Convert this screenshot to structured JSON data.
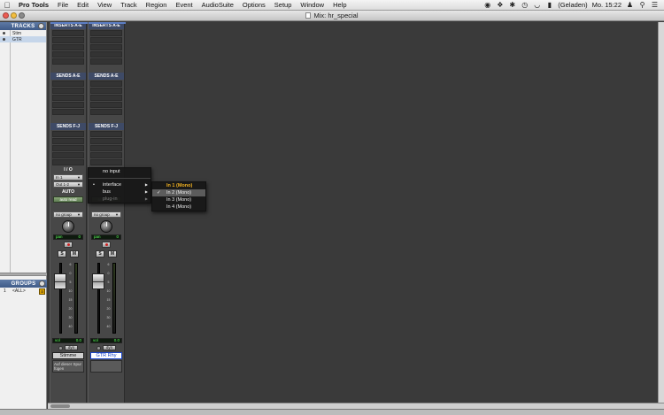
{
  "menubar": {
    "items": [
      "Pro Tools",
      "File",
      "Edit",
      "View",
      "Track",
      "Region",
      "Event",
      "AudioSuite",
      "Options",
      "Setup",
      "Window",
      "Help"
    ],
    "battery": "(Geladen)",
    "clock": "Mo. 15:22"
  },
  "window": {
    "title": "Mix: hr_special"
  },
  "tracks_panel": {
    "title": "TRACKS",
    "rows": [
      "Stim",
      "GTR"
    ]
  },
  "groups_panel": {
    "title": "GROUPS",
    "row": {
      "id": "1",
      "name": "<ALL>"
    }
  },
  "strips": [
    {
      "inserts_ae": "INSERTS A-E",
      "sends_ae": "SENDS A-E",
      "sends_fj": "SENDS F-J",
      "io": "I / O",
      "input": "In 1",
      "output": "Out 1-2",
      "auto": "AUTO",
      "auto_mode": "auto read",
      "group": "no group",
      "pan_label": "pan",
      "pan_value": "0",
      "solo": "S",
      "mute": "M",
      "vol_label": "vol",
      "vol_value": "0.0",
      "dyn": "dyn",
      "name": "Stimme",
      "comment": "Auf dieser Spur fügen"
    },
    {
      "inserts_ae": "INSERTS A-E",
      "sends_ae": "SENDS A-E",
      "sends_fj": "SENDS F-J",
      "auto_mode": "auto read",
      "group": "no group",
      "pan_label": "pan",
      "pan_value": "0",
      "solo": "S",
      "mute": "M",
      "vol_label": "vol",
      "vol_value": "0.0",
      "dyn": "dyn",
      "name": "GTR Rhy"
    }
  ],
  "meter_scale": [
    "6",
    "0",
    "5",
    "10",
    "15",
    "20",
    "30",
    "40"
  ],
  "input_menu": {
    "items": [
      {
        "label": "no input"
      },
      {
        "label": "interface",
        "submenu": true,
        "checked": true
      },
      {
        "label": "bus",
        "submenu": true
      },
      {
        "label": "plug-in",
        "submenu": true,
        "disabled": true
      }
    ]
  },
  "interface_submenu": {
    "items": [
      {
        "label": "In 1 (Mono)",
        "current": true
      },
      {
        "label": "In 2 (Mono)",
        "checked": true,
        "highlighted": true
      },
      {
        "label": "In 3 (Mono)"
      },
      {
        "label": "In 4 (Mono)"
      }
    ]
  },
  "colors": {
    "accent": "#f0b020",
    "selected_name": "#1a44c8",
    "panel_header": "#3f5b88"
  }
}
